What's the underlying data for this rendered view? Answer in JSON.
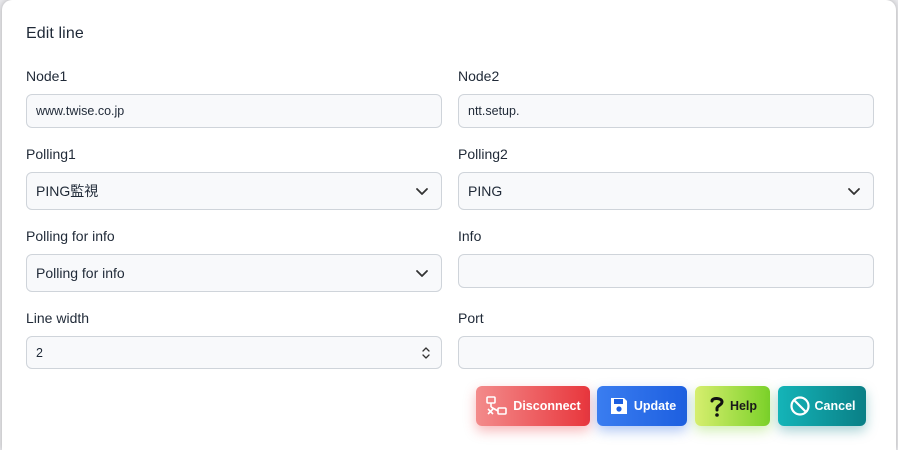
{
  "dialog": {
    "title": "Edit line"
  },
  "fields": {
    "node1": {
      "label": "Node1",
      "value": "www.twise.co.jp"
    },
    "node2": {
      "label": "Node2",
      "value": "ntt.setup."
    },
    "polling1": {
      "label": "Polling1",
      "value": "PING監視"
    },
    "polling2": {
      "label": "Polling2",
      "value": "PING"
    },
    "polling_info": {
      "label": "Polling for info",
      "value": "Polling for info"
    },
    "info": {
      "label": "Info",
      "value": ""
    },
    "line_width": {
      "label": "Line width",
      "value": "2"
    },
    "port": {
      "label": "Port",
      "value": ""
    }
  },
  "buttons": {
    "disconnect": {
      "label": "Disconnect",
      "icon": "network-disconnect-icon",
      "color": "#e8363c"
    },
    "update": {
      "label": "Update",
      "icon": "floppy-disk-icon",
      "color": "#1d5fe0"
    },
    "help": {
      "label": "Help",
      "icon": "question-mark-icon",
      "color": "#7bd129"
    },
    "cancel": {
      "label": "Cancel",
      "icon": "ban-icon",
      "color": "#0a7f86"
    }
  }
}
